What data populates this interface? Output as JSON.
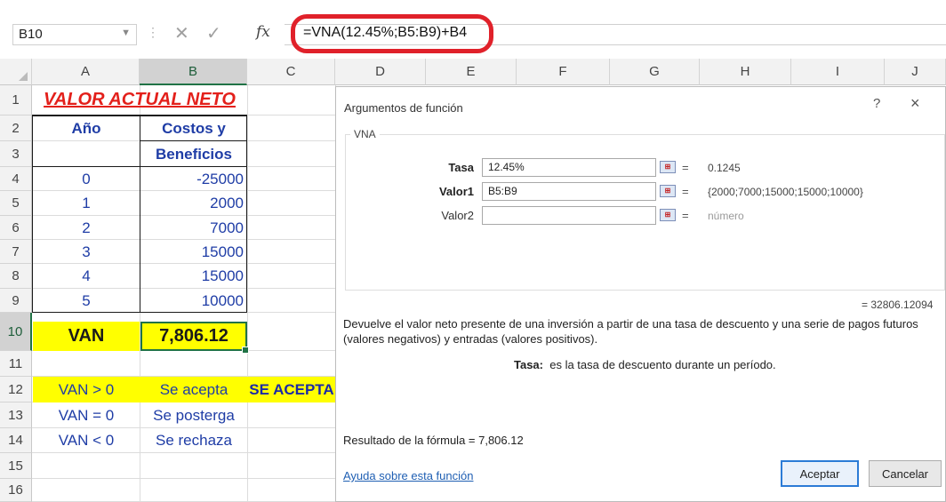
{
  "formula_bar": {
    "name_box": "B10",
    "fx_label": "fx",
    "formula": "=VNA(12.45%;B5:B9)+B4"
  },
  "columns": [
    "A",
    "B",
    "C",
    "D",
    "E",
    "F",
    "G",
    "H",
    "I",
    "J"
  ],
  "rows": [
    "1",
    "2",
    "3",
    "4",
    "5",
    "6",
    "7",
    "8",
    "9",
    "10",
    "11",
    "12",
    "13",
    "14",
    "15",
    "16"
  ],
  "sheet": {
    "title": "VALOR ACTUAL NETO",
    "header_year": "Año",
    "header_costs_1": "Costos y",
    "header_costs_2": "Beneficios",
    "data": [
      {
        "year": "0",
        "value": "-25000"
      },
      {
        "year": "1",
        "value": "2000"
      },
      {
        "year": "2",
        "value": "7000"
      },
      {
        "year": "3",
        "value": "15000"
      },
      {
        "year": "4",
        "value": "15000"
      },
      {
        "year": "5",
        "value": "10000"
      }
    ],
    "van_label": "VAN",
    "van_value": "7,806.12",
    "rules": [
      {
        "cond": "VAN > 0",
        "result": "Se acepta"
      },
      {
        "cond": "VAN = 0",
        "result": "Se posterga"
      },
      {
        "cond": "VAN < 0",
        "result": "Se rechaza"
      }
    ],
    "verdict": "SE ACEPTA"
  },
  "dialog": {
    "title": "Argumentos de función",
    "help": "?",
    "close": "×",
    "function_name": "VNA",
    "args": [
      {
        "label": "Tasa",
        "value": "12.45%",
        "result": "0.1245",
        "bold": true
      },
      {
        "label": "Valor1",
        "value": "B5:B9",
        "result": "{2000;7000;15000;15000;10000}",
        "bold": true
      },
      {
        "label": "Valor2",
        "value": "",
        "result": "número",
        "bold": false
      }
    ],
    "equals": "=",
    "total_result": "=  32806.12094",
    "description": "Devuelve el valor neto presente de una inversión a partir de una tasa de descuento y una serie de pagos futuros (valores negativos) y entradas (valores positivos).",
    "arg_desc_label": "Tasa:",
    "arg_desc_text": "es la tasa de descuento durante un período.",
    "formula_result": "Resultado de la fórmula =   7,806.12",
    "help_link": "Ayuda sobre esta función",
    "ok_label": "Aceptar",
    "cancel_label": "Cancelar"
  },
  "colors": {
    "title_red": "#e3201b",
    "value_blue": "#1f3da6",
    "highlight_yellow": "#ffff00",
    "excel_green": "#217346",
    "callout_red": "#e0212a"
  }
}
